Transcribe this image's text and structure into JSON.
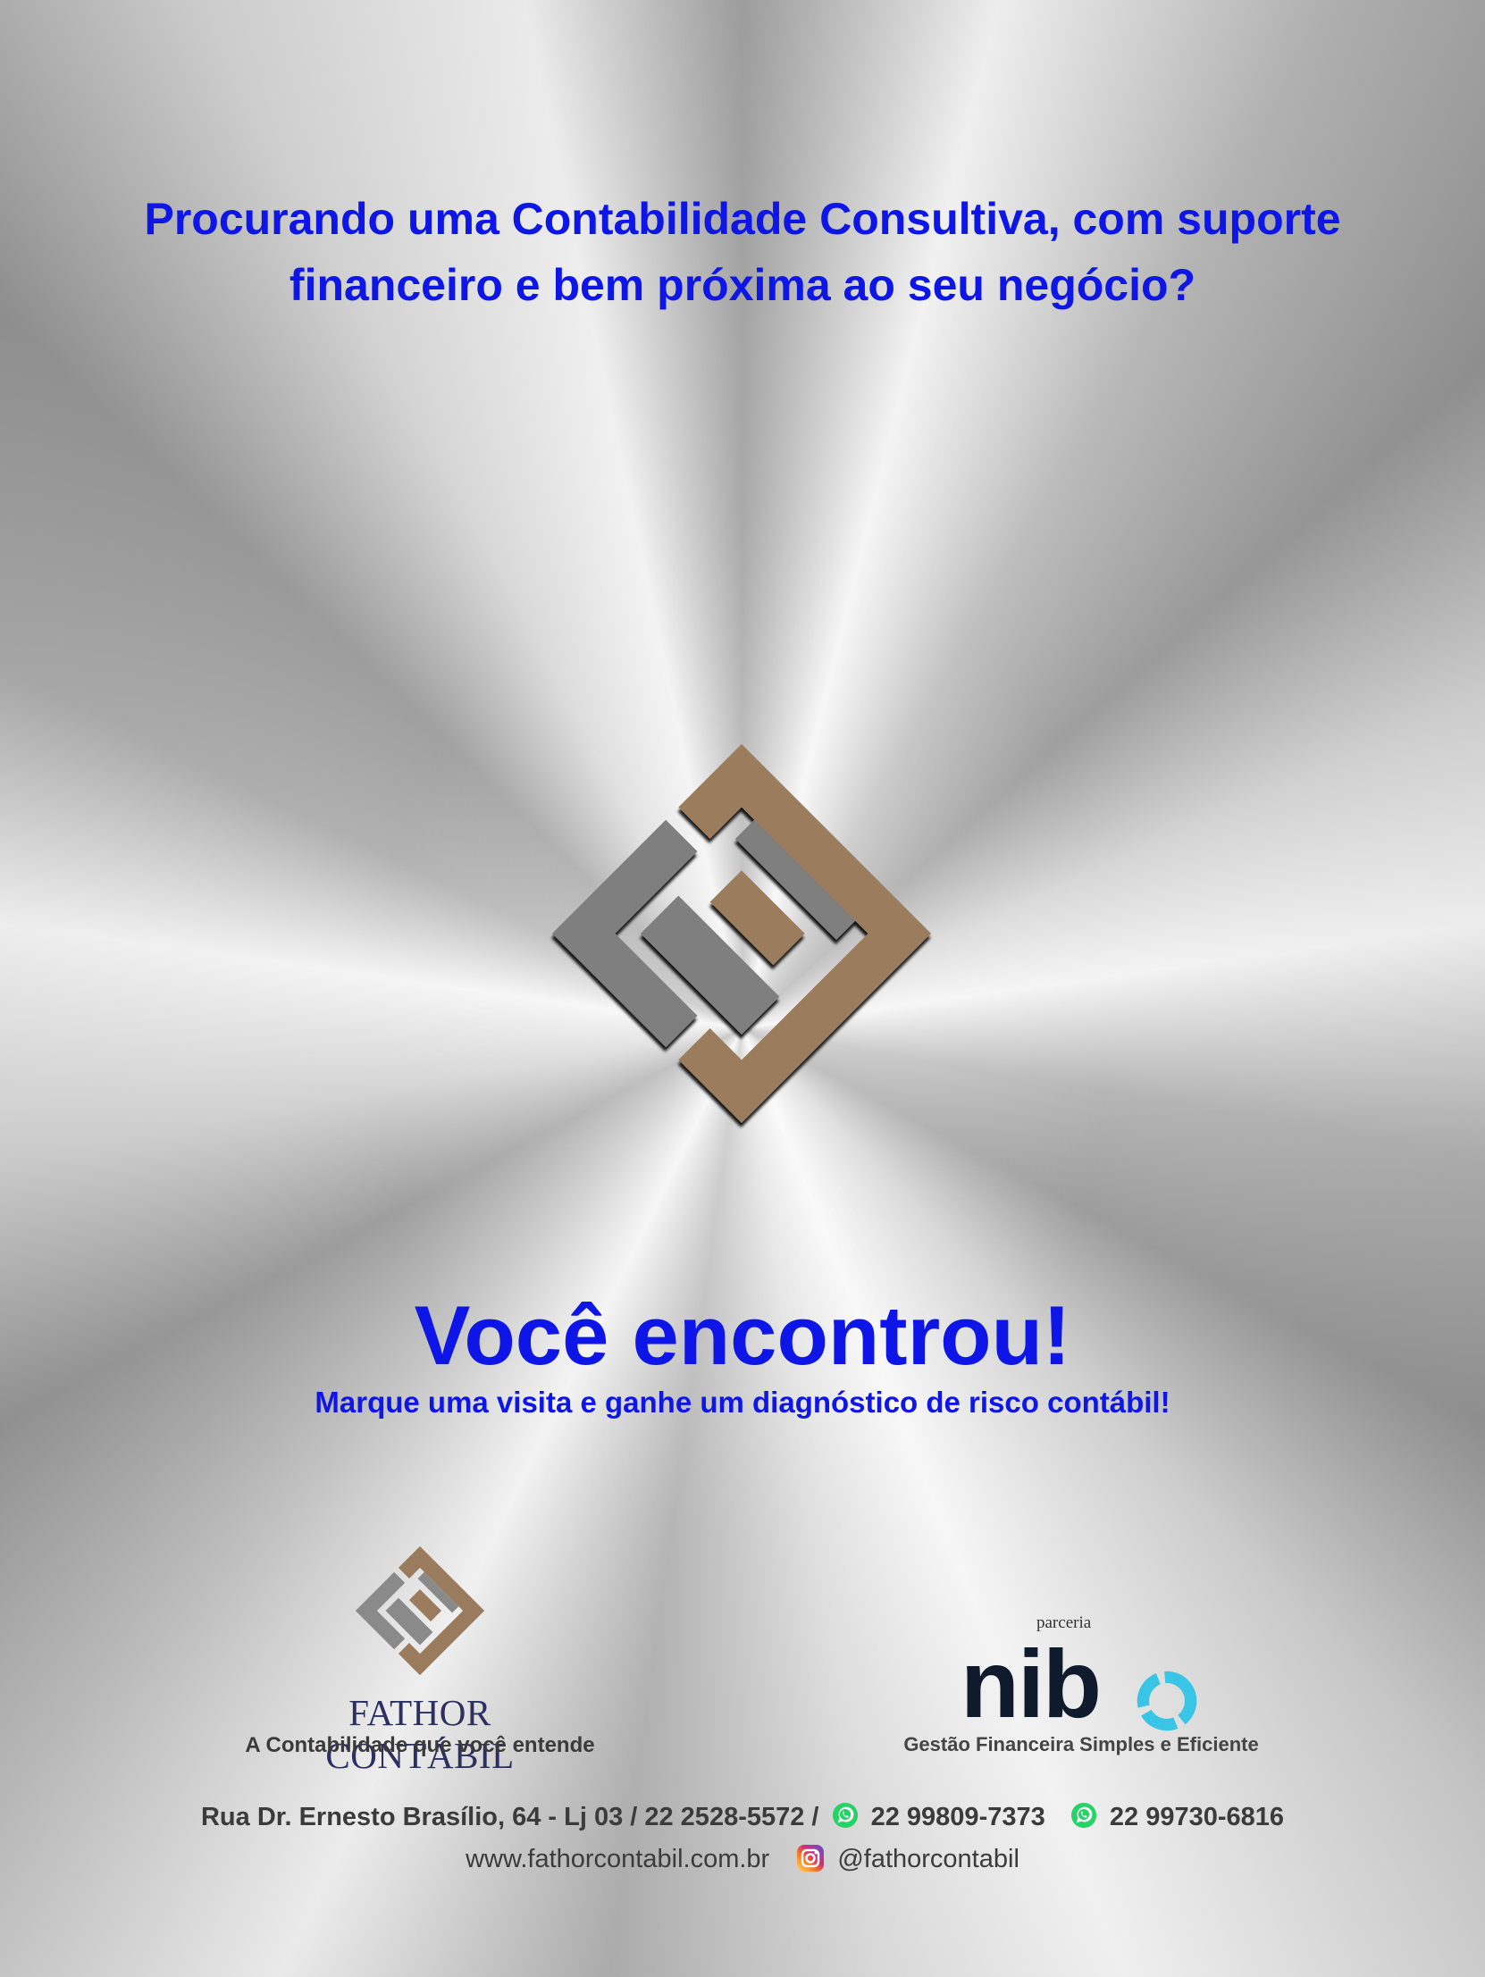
{
  "headline": {
    "line1": "Procurando uma Contabilidade Consultiva, com suporte",
    "line2": "financeiro e bem próxima ao seu negócio?"
  },
  "main": {
    "found": "Você encontrou!",
    "offer": "Marque uma visita e ganhe um diagnóstico de risco contábil!"
  },
  "fathor": {
    "name": "FATHOR CONTÁBIL",
    "tagline": "A Contabilidade que você entende"
  },
  "partner": {
    "label": "parceria",
    "name": "nib",
    "tagline": "Gestão Financeira Simples e Eficiente"
  },
  "contact": {
    "address_phone": "Rua Dr. Ernesto Brasílio, 64 - Lj 03 / 22 2528-5572 /",
    "whatsapp1": "22 99809-7373",
    "whatsapp2": "22 99730-6816",
    "website": "www.fathorcontabil.com.br",
    "instagram": "@fathorcontabil"
  },
  "icons": [
    "whatsapp-icon",
    "instagram-icon"
  ],
  "colors": {
    "headline_blue": "#0d16e6",
    "logo_brown": "#9b7b5d",
    "logo_gray": "#7f7f7f",
    "nibo_cyan": "#39c6e6",
    "whatsapp_green": "#25d366"
  }
}
